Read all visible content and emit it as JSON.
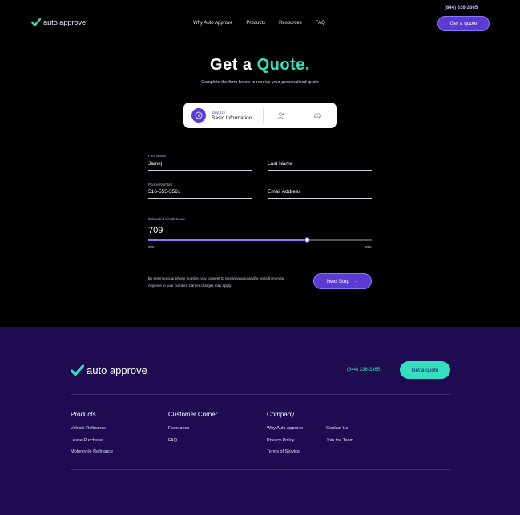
{
  "header": {
    "phone": "(844) 336-3365",
    "logo_text": "auto approve",
    "nav": [
      "Why Auto Approve",
      "Products",
      "Resources",
      "FAQ"
    ],
    "cta": "Get a quote"
  },
  "hero": {
    "title_main": "Get a",
    "title_accent": "Quote.",
    "subtitle": "Complete the form below to receive your personalized quote"
  },
  "stepper": {
    "step_small": "Step 1/3",
    "step_label": "Basic Information",
    "icons": [
      "info-icon",
      "person-icon",
      "car-icon"
    ]
  },
  "form": {
    "first_name": {
      "label": "First Name",
      "value": "Jame|"
    },
    "last_name": {
      "label": "",
      "placeholder": "Last Name"
    },
    "phone": {
      "label": "Phone Number",
      "value": "516-555-3561"
    },
    "email": {
      "label": "",
      "placeholder": "Email Address"
    },
    "credit": {
      "label": "Estimated Credit Score",
      "value": "709",
      "min": "300",
      "max": "850",
      "fraction": 0.71
    },
    "consent": "By entering your phone number, you consent to receiving auto and/or texts from Auto Approve to your number. Carrier charges may apply.",
    "next": "Next Step"
  },
  "footer": {
    "logo_text": "auto approve",
    "phone": "(844) 336-3365",
    "cta": "Get a quote",
    "columns": [
      {
        "heading": "Products",
        "links": [
          "Vehicle Refinance",
          "Lease Purchase",
          "Motorcycle Refinance"
        ]
      },
      {
        "heading": "Customer Corner",
        "links": [
          "Resources",
          "FAQ"
        ]
      },
      {
        "heading": "Company",
        "links": [
          "Why Auto Approve",
          "Privacy Policy",
          "Terms of Service"
        ]
      },
      {
        "heading": "",
        "links": [
          "Contact Us",
          "Join the Team"
        ]
      }
    ]
  },
  "colors": {
    "brand": "#5b3bd1",
    "accent": "#35e0c0",
    "footer_bg": "#1e0b52"
  }
}
